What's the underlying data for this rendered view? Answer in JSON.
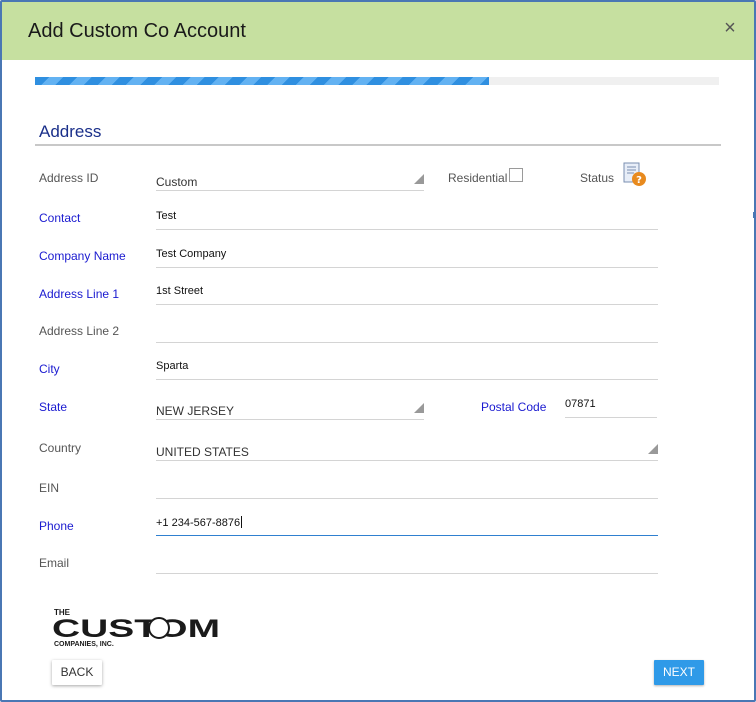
{
  "dialog": {
    "title": "Add Custom Co Account",
    "close_glyph": "×",
    "progress_fraction": 0.664
  },
  "section": {
    "title": "Address"
  },
  "fields": {
    "address_id": {
      "label": "Address ID",
      "value": "Custom"
    },
    "residential": {
      "label": "Residential",
      "checked": false
    },
    "status": {
      "label": "Status",
      "icon": "document-question-icon"
    },
    "contact": {
      "label": "Contact",
      "value": "Test"
    },
    "company_name": {
      "label": "Company Name",
      "value": "Test Company"
    },
    "address_line1": {
      "label": "Address Line 1",
      "value": "1st Street"
    },
    "address_line2": {
      "label": "Address Line 2",
      "value": ""
    },
    "city": {
      "label": "City",
      "value": "Sparta"
    },
    "state": {
      "label": "State",
      "value": "NEW JERSEY"
    },
    "postal_code": {
      "label": "Postal Code",
      "value": "07871"
    },
    "country": {
      "label": "Country",
      "value": "UNITED STATES"
    },
    "ein": {
      "label": "EIN",
      "value": ""
    },
    "phone": {
      "label": "Phone",
      "value": "+1 234-567-8876"
    },
    "email": {
      "label": "Email",
      "value": ""
    }
  },
  "logo": {
    "line1": "THE",
    "line2": "CUSTOM",
    "line3": "COMPANIES, INC."
  },
  "buttons": {
    "back": "BACK",
    "next": "NEXT"
  },
  "colors": {
    "header_bg": "#c6e0a0",
    "required_label": "#1a1ad0",
    "accent_blue": "#2f9ae8",
    "section_title": "#1a2f8a"
  }
}
